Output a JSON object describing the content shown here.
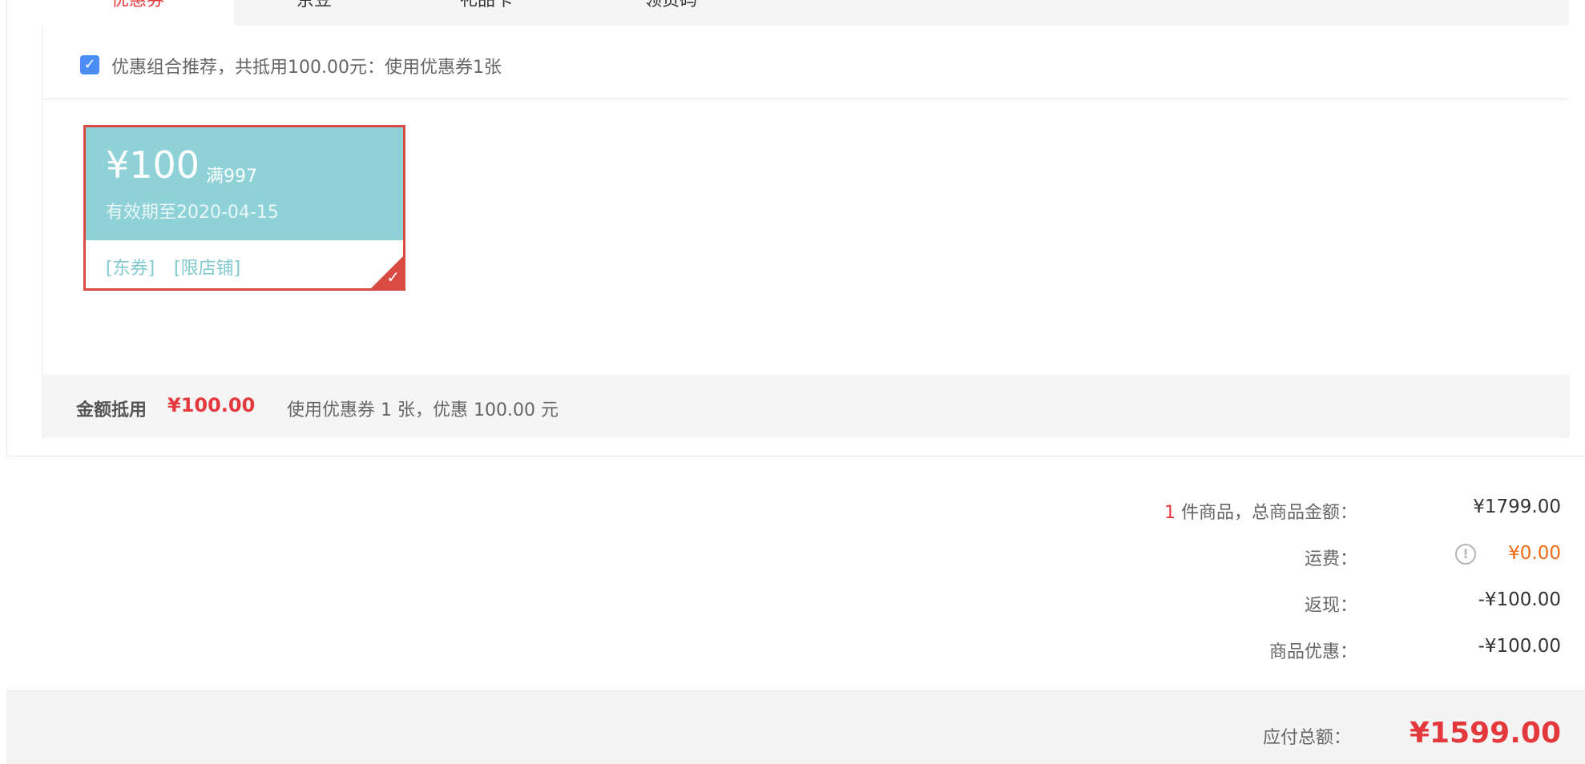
{
  "tabs": [
    {
      "label": "优惠券",
      "active": true
    },
    {
      "label": "京豆",
      "active": false
    },
    {
      "label": "礼品卡",
      "active": false
    },
    {
      "label": "领货码",
      "active": false
    }
  ],
  "recommend": {
    "checked": true,
    "text": "优惠组合推荐，共抵用100.00元：使用优惠券1张"
  },
  "coupon": {
    "amount": "¥100",
    "condition": "满997",
    "validity": "有效期至2020-04-15",
    "tags": [
      "[东券]",
      "[限店铺]"
    ],
    "selected": true
  },
  "summary": {
    "label": "金额抵用",
    "amount": "¥100.00",
    "desc": "使用优惠券 1 张，优惠 100.00 元"
  },
  "totals": {
    "item_count": "1",
    "item_label": "件商品，总商品金额：",
    "item_amount": "¥1799.00",
    "shipping_label": "运费：",
    "shipping_amount": "¥0.00",
    "rebate_label": "返现：",
    "rebate_amount": "-¥100.00",
    "discount_label": "商品优惠：",
    "discount_amount": "-¥100.00"
  },
  "payment": {
    "label": "应付总额：",
    "amount": "¥1599.00"
  },
  "colors": {
    "accent_red": "#e4393c",
    "coupon_teal": "#8ed1d6",
    "shipping_orange": "#f06a15",
    "checkbox_blue": "#4a8ef5"
  }
}
